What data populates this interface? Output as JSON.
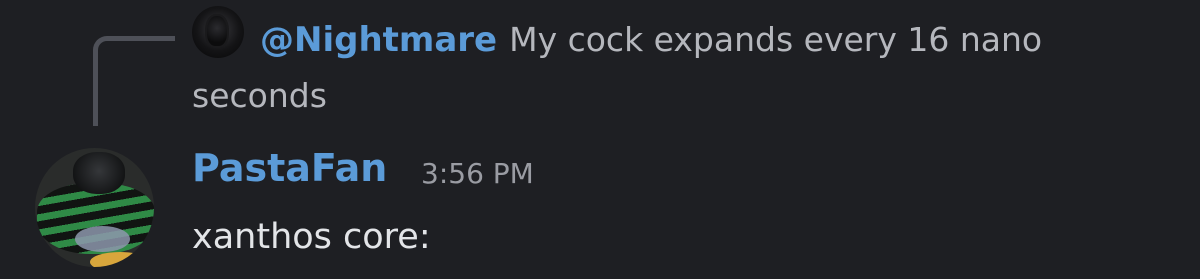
{
  "reply": {
    "mention": "@Nightmare",
    "text": "My cock expands every 16 nano seconds",
    "avatar_icon": "dark-figure-avatar"
  },
  "message": {
    "author": "PastaFan",
    "timestamp": "3:56 PM",
    "content": "xanthos core:",
    "avatar_icon": "pug-in-striped-shirt-avatar"
  },
  "colors": {
    "background": "#1e1f23",
    "mention": "#5b9bd8",
    "author": "#5b9bd8",
    "reply_text": "#b5b7bd",
    "timestamp": "#9a9ca3",
    "content": "#e3e5e8",
    "connector": "#4e5058"
  }
}
